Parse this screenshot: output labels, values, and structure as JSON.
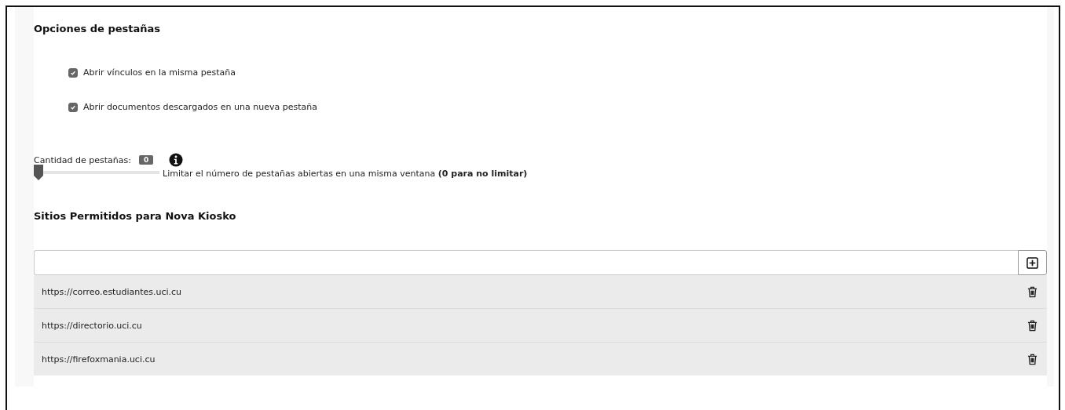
{
  "section_title": "Opciones de pestañas",
  "options": [
    {
      "label": "Abrir vínculos en la misma pestaña",
      "checked": true
    },
    {
      "label": "Abrir documentos descargados en una nueva pestaña",
      "checked": true
    }
  ],
  "tab_count": {
    "label": "Cantidad de pestañas:",
    "value": "0",
    "level": 0,
    "hint": "Limitar el número de pestañas abiertas en una misma ventana **(0 para no limitar)**"
  },
  "sites": {
    "title": "Sitios Permitidos para Nova Kiosko",
    "rows": [
      "https://correo.estudiantes.uci.cu",
      "https://directorio.uci.cu",
      "https://firefoxmania.uci.cu"
    ]
  }
}
